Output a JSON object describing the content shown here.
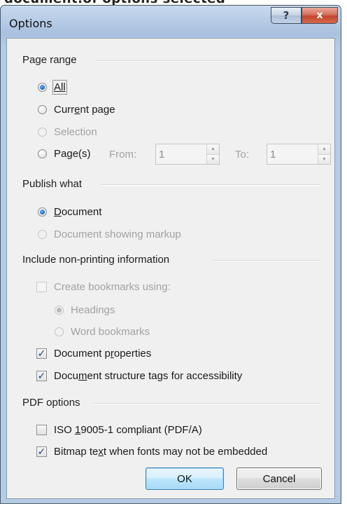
{
  "top_strip": {
    "text": "document.of options selected"
  },
  "dialog": {
    "title": "Options",
    "help_glyph": "?",
    "close_glyph": "x"
  },
  "page_range": {
    "heading": "Page range",
    "all_label": "All",
    "current_label_a": "Curr",
    "current_label_u": "e",
    "current_label_b": "nt page",
    "selection_label": "Selection",
    "pages_label_a": "Pa",
    "pages_label_u": "g",
    "pages_label_b": "e(s)",
    "from_label": "From:",
    "from_value": "1",
    "to_label": "To:",
    "to_value": "1"
  },
  "publish_what": {
    "heading": "Publish what",
    "document_u": "D",
    "document_rest": "ocument",
    "markup_label": "Document showing markup"
  },
  "non_printing": {
    "heading": "Include non-printing information",
    "bookmarks_label": "Create bookmarks using:",
    "headings_label": "Headings",
    "word_bookmarks_label": "Word bookmarks",
    "doc_props_a": "Document p",
    "doc_props_u": "r",
    "doc_props_b": "operties",
    "structure_a": "Docu",
    "structure_u": "m",
    "structure_b": "ent structure tags for accessibility"
  },
  "pdf_options": {
    "heading": "PDF options",
    "iso_a": "ISO ",
    "iso_u": "1",
    "iso_b": "9005-1 compliant (PDF/A)",
    "bitmap_a": "Bitmap te",
    "bitmap_u": "x",
    "bitmap_b": "t when fonts may not be embedded"
  },
  "buttons": {
    "ok": "OK",
    "cancel": "Cancel"
  },
  "state": {
    "page_range_selected": "All",
    "publish_selected": "Document",
    "create_bookmarks": false,
    "document_properties": true,
    "structure_tags": true,
    "iso_compliant": false,
    "bitmap_text": true
  }
}
